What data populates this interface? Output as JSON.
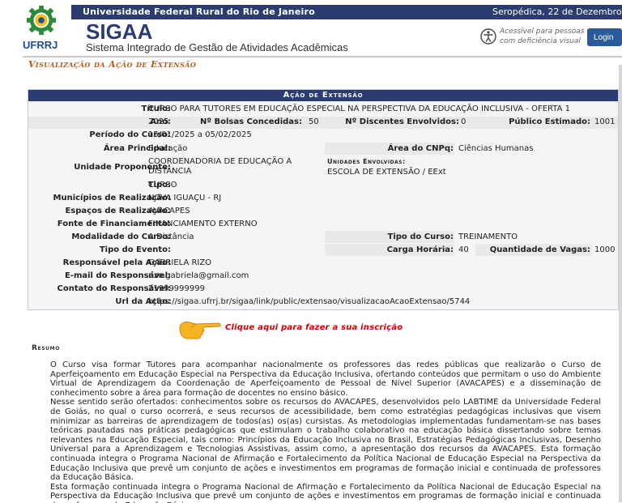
{
  "header": {
    "university": "Universidade Federal Rural do Rio de Janeiro",
    "date": "Seropédica, 22 de Dezembro de 20",
    "logo_text": "UFRRJ",
    "app_name": "SIGAA",
    "app_subtitle": "Sistema Integrado de Gestão de Atividades Acadêmicas",
    "accessibility_line1": "Acessível para pessoas",
    "accessibility_line2": "com deficiência visual",
    "login_label": "Login"
  },
  "page_title": "Visualização da Ação de Extensão",
  "panel": {
    "title": "Ação de Extensão",
    "fields": {
      "titulo_label": "Título:",
      "titulo": "CURSO PARA TUTORES EM EDUCAÇÃO ESPECIAL NA PERSPECTIVA DA EDUCAÇÃO INCLUSIVA - OFERTA 1",
      "ano_label": "Ano:",
      "ano": "2025",
      "bolsas_label": "Nº Bolsas Concedidas:",
      "bolsas": "50",
      "discentes_label": "Nº Discentes Envolvidos:",
      "discentes": "0",
      "publico_label": "Público Estimado:",
      "publico": "1001",
      "periodo_label": "Período do Curso:",
      "periodo": "15/01/2025 a 05/02/2025",
      "area_principal_label": "Área Principal:",
      "area_principal": "Educação",
      "area_cnpq_label": "Área do CNPq:",
      "area_cnpq": "Ciências Humanas",
      "unidade_label": "Unidade Proponente:",
      "unidade_line1": "COORDENADORIA DE EDUCAÇÃO A",
      "unidade_line2": "DISTÂNCIA",
      "unidades_env_label": "Unidades Envolvidas:",
      "unidades_env": "ESCOLA DE EXTENSÃO / EExt",
      "tipo_label": "Tipo:",
      "tipo": "CURSO",
      "municipios_label": "Municípios de Realização:",
      "municipios": "NOVA IGUAÇU - RJ",
      "espacos_label": "Espaços de Realização:",
      "espacos": "AVACAPES",
      "fonte_label": "Fonte de Financiamento:",
      "fonte": "FINANCIAMENTO EXTERNO",
      "modalidade_label": "Modalidade do Curso:",
      "modalidade": "A Distância",
      "tipo_curso_label": "Tipo do Curso:",
      "tipo_curso": "TREINAMENTO",
      "tipo_evento_label": "Tipo do Evento:",
      "tipo_evento": "",
      "carga_label": "Carga Horária:",
      "carga": "40",
      "vagas_label": "Quantidade de Vagas:",
      "vagas": "1000",
      "responsavel_label": "Responsável pela Ação:",
      "responsavel": "GABRIELA RIZO",
      "email_label": "E-mail do Responsável:",
      "email": "rizo.gabriela@gmail.com",
      "contato_label": "Contato do Responsável:",
      "contato": "21999999999",
      "url_label": "Url da Ação:",
      "url": "https://sigaa.ufrrj.br/sigaa/link/public/extensao/visualizacaoAcaoExtensao/5744"
    }
  },
  "cta_text": "Clique aqui para fazer a sua inscrição",
  "resumo_title": "Resumo",
  "resumo_paragraphs": [
    "O Curso visa formar Tutores  para acompanhar nacionalmente os professores das redes públicas que realizarão o Curso de Aperfeiçoamento em Educação Especial na Perspectiva da Educação Inclusiva, ofertando conteúdos que permitam o uso do Ambiente Virtual de Aprendizagem da Coordenação de Aperfeiçoamento de Pessoal de Nível Superior (AVACAPES) e a disseminação de conhecimento sobre a área para formação de docentes no ensino básico.",
    "Nesse sentido serão ofertados: conhecimentos sobre os recursos do AVACAPES, desenvolvidos pelo LABTIME da Universidade Federal de Goiás, no qual o curso ocorrerá, e seus recursos de acessibilidade, bem como estratégias pedagógicas inclusivas que visem minimizar as barreiras de aprendizagem de todos(as) os(as) cursistas. As metodologias implementadas fundamentam-se nas bases teóricas pautadas nas práticas pedagógicas que estimulam o trabalho colaborativo na educação básica dissertando sobre temas relevantes na Educação Especial, tais como: Princípios da Educação Inclusiva no Brasil, Estratégias Pedagógicas Inclusivas, Desenho Universal para a Aprendizagem e Tecnologias Assistivas, assim como, a apresentação dos recursos da AVACAPES. Esta formação continuada integra o Programa Nacional de Afirmação e Fortalecimento da Política Nacional de Educação Especial na Perspectiva da Educação Inclusiva que prevê um conjunto de ações e investimentos em programas de formação inicial e continuada de professores da Educação Básica.",
    "Esta formação continuada integra o Programa Nacional de Afirmação e Fortalecimento da Política Nacional de Educação Especial na Perspectiva da Educação Inclusiva que prevê um conjunto de ações e investimentos em programas de formação inicial e continuada de professores da Educação Básica."
  ]
}
